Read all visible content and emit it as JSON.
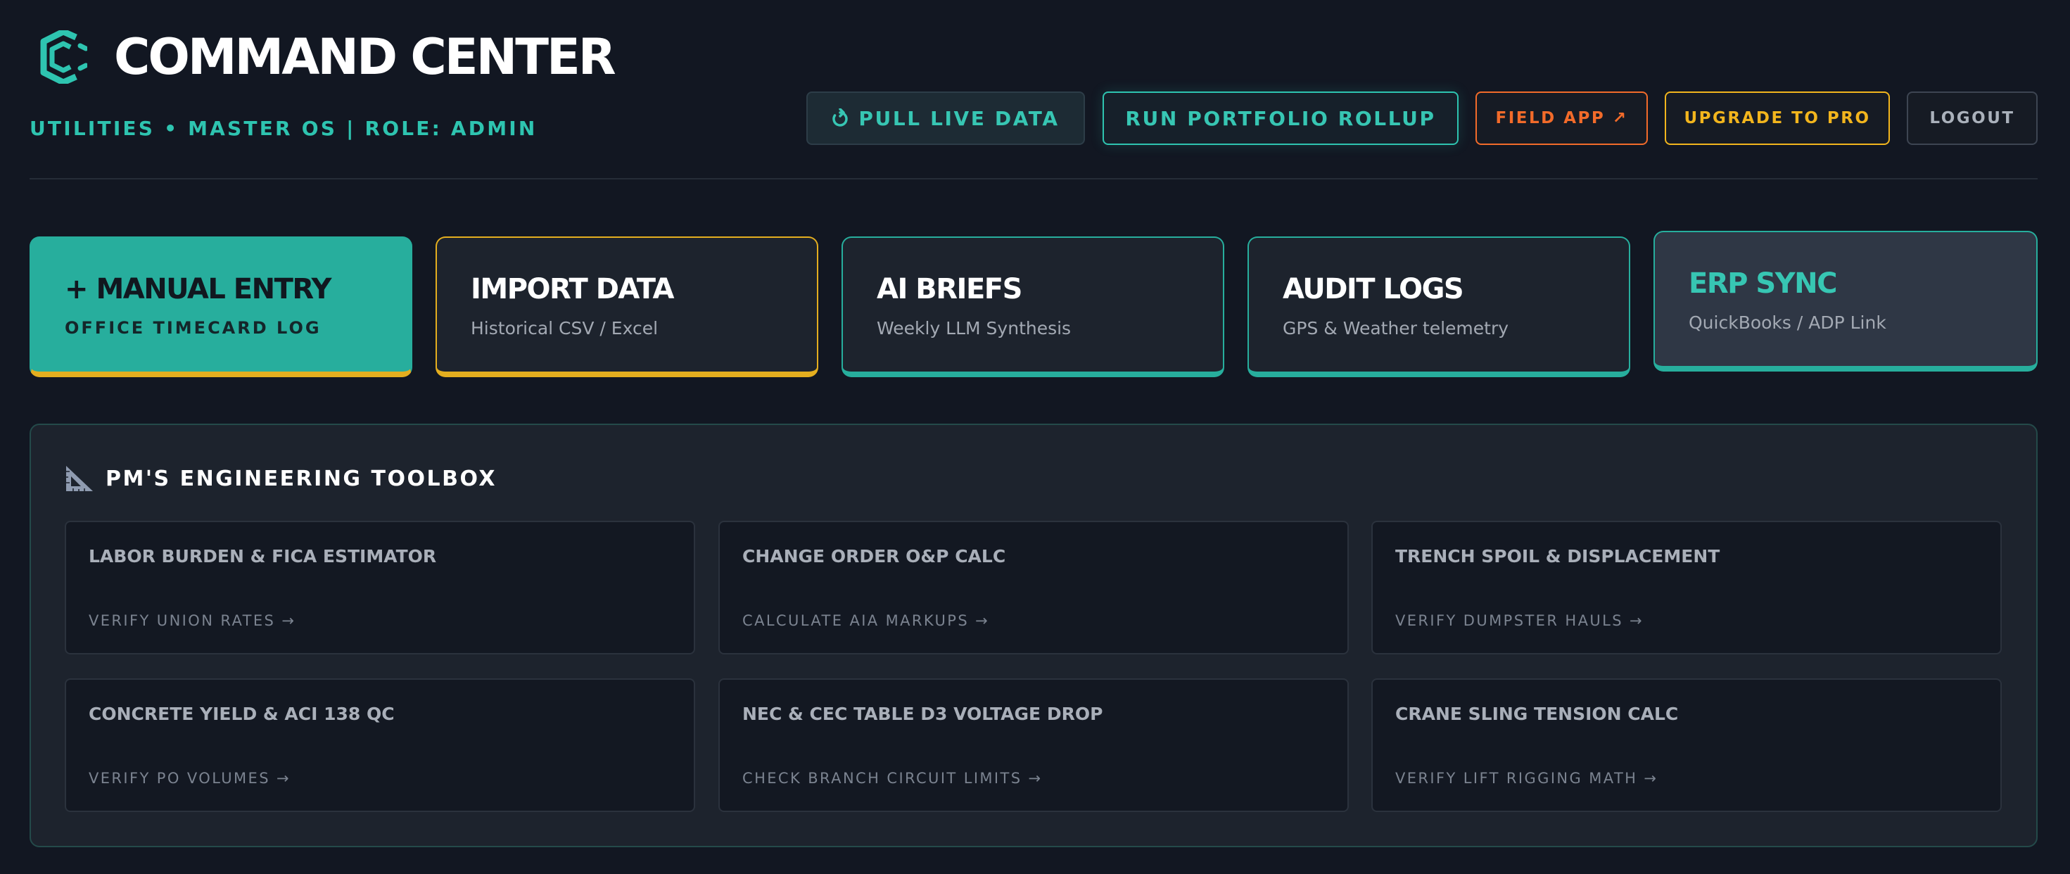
{
  "header": {
    "app_title": "COMMAND CENTER",
    "subtitle": "UTILITIES • MASTER OS | ROLE: ADMIN"
  },
  "actions": {
    "pull_live_data": "PULL LIVE DATA",
    "run_portfolio_rollup": "RUN PORTFOLIO ROLLUP",
    "field_app": "FIELD APP ↗",
    "upgrade": "UPGRADE TO PRO",
    "logout": "LOGOUT"
  },
  "nav_cards": [
    {
      "title": "+ MANUAL ENTRY",
      "subtitle": "OFFICE TIMECARD LOG"
    },
    {
      "title": "IMPORT DATA",
      "subtitle": "Historical CSV / Excel"
    },
    {
      "title": "AI BRIEFS",
      "subtitle": "Weekly LLM Synthesis"
    },
    {
      "title": "AUDIT LOGS",
      "subtitle": "GPS & Weather telemetry"
    },
    {
      "title": "ERP SYNC",
      "subtitle": "QuickBooks / ADP Link"
    }
  ],
  "toolbox": {
    "title": "PM'S ENGINEERING TOOLBOX",
    "tools": [
      {
        "name": "LABOR BURDEN & FICA ESTIMATOR",
        "link": "VERIFY UNION RATES →"
      },
      {
        "name": "CHANGE ORDER O&P CALC",
        "link": "CALCULATE AIA MARKUPS →"
      },
      {
        "name": "TRENCH SPOIL & DISPLACEMENT",
        "link": "VERIFY DUMPSTER HAULS →"
      },
      {
        "name": "CONCRETE YIELD & ACI 138 QC",
        "link": "VERIFY PO VOLUMES →"
      },
      {
        "name": "NEC & CEC TABLE D3 VOLTAGE DROP",
        "link": "CHECK BRANCH CIRCUIT LIMITS →"
      },
      {
        "name": "CRANE SLING TENSION CALC",
        "link": "VERIFY LIFT RIGGING MATH →"
      }
    ]
  },
  "icons": {
    "logo": "logo-icon",
    "refresh": "refresh-icon",
    "toolbox": "triangle-ruler-icon"
  },
  "colors": {
    "background": "#121722",
    "accent_teal": "#2ec4b0",
    "accent_amber": "#e4ae1f",
    "accent_orange": "#f26b2a",
    "card_bg": "#1d232d"
  }
}
